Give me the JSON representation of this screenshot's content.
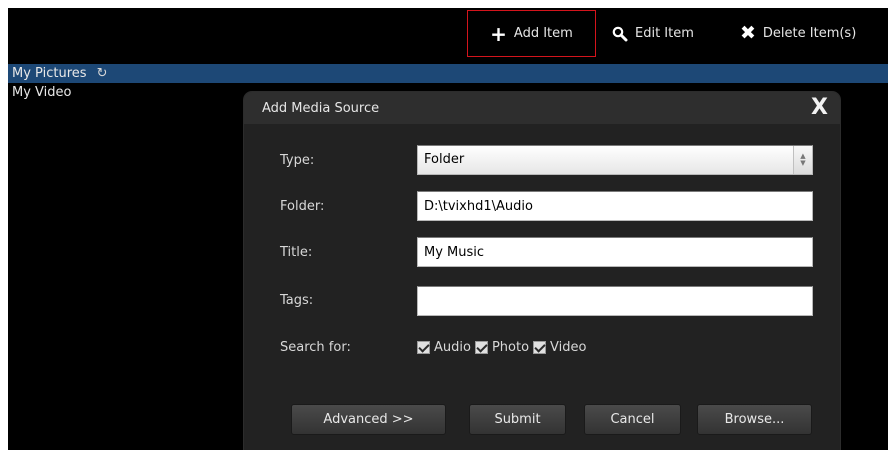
{
  "toolbar": {
    "add_label": "Add Item",
    "edit_label": "Edit Item",
    "delete_label": "Delete Item(s)",
    "add_icon": "plus-icon",
    "edit_icon": "search-icon",
    "delete_icon": "x-icon",
    "highlight_color": "#d4141c"
  },
  "list": {
    "items": [
      {
        "label": "My Pictures",
        "selected": true
      },
      {
        "label": "My Video",
        "selected": false
      }
    ],
    "selected_color": "#1d4876"
  },
  "dialog": {
    "title": "Add Media Source",
    "close_label": "X",
    "type_label": "Type:",
    "type_value": "Folder",
    "folder_label": "Folder:",
    "folder_value": "D:\\tvixhd1\\Audio",
    "title_label": "Title:",
    "title_value": "My Music",
    "tags_label": "Tags:",
    "tags_value": "",
    "search_label": "Search for:",
    "search_options": [
      {
        "label": "Audio",
        "checked": true
      },
      {
        "label": "Photo",
        "checked": true
      },
      {
        "label": "Video",
        "checked": true
      }
    ],
    "buttons": {
      "advanced": "Advanced >>",
      "submit": "Submit",
      "cancel": "Cancel",
      "browse": "Browse..."
    }
  }
}
